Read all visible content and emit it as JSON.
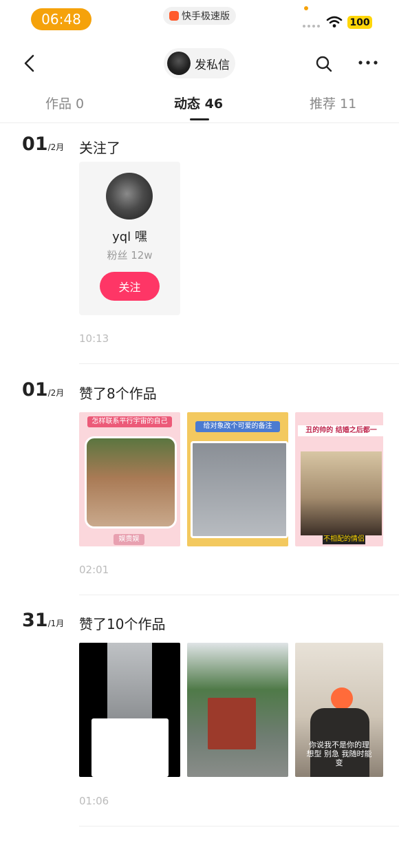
{
  "status_bar": {
    "time": "06:48",
    "app_name": "快手极速版",
    "battery": "100"
  },
  "header": {
    "profile_label": "发私信"
  },
  "tabs": [
    {
      "label": "作品 0"
    },
    {
      "label": "动态 46",
      "active": true
    },
    {
      "label": "推荐 11"
    }
  ],
  "feed": [
    {
      "day": "01",
      "month": "/2月",
      "title": "关注了",
      "follow_card": {
        "name": "yql 嘿",
        "fans": "粉丝 12w",
        "button": "关注"
      },
      "time": "10:13"
    },
    {
      "day": "01",
      "month": "/2月",
      "title": "赞了8个作品",
      "thumbs": [
        {
          "top_text": "怎样联系平行宇宙的自己",
          "bottom_text": "娱贵娱"
        },
        {
          "top_text": "给对象改个可爱的备注",
          "bottom_text": ""
        },
        {
          "top_text": "丑的帅的 结婚之后都一",
          "bottom_text": "不相配的情侣"
        }
      ],
      "time": "02:01"
    },
    {
      "day": "31",
      "month": "/1月",
      "title": "赞了10个作品",
      "thumbs": [
        {
          "top_text": "",
          "bottom_text": ""
        },
        {
          "top_text": "",
          "bottom_text": ""
        },
        {
          "top_text": "",
          "bottom_text": "你说我不是你的理想型 别急 我随时能变"
        }
      ],
      "time": "01:06"
    }
  ],
  "colors": {
    "accent": "#fe3666",
    "status_pill": "#f5a20b"
  }
}
